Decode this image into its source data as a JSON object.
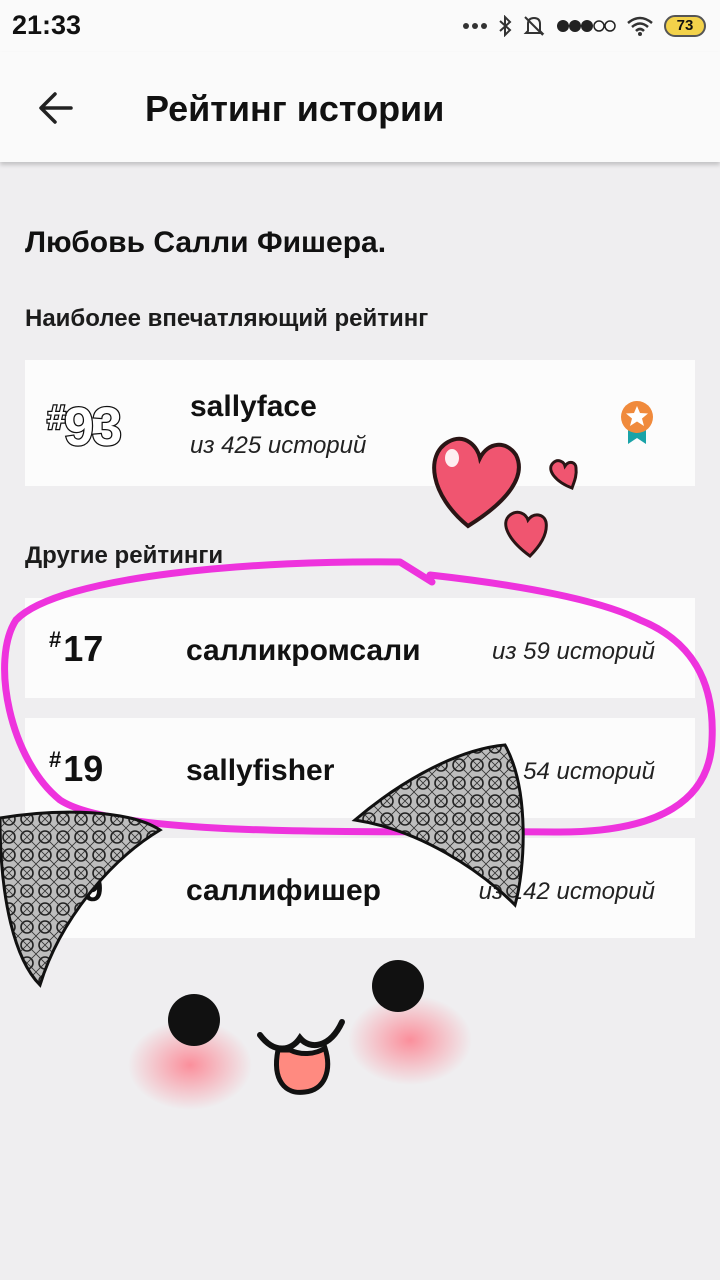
{
  "status_bar": {
    "time": "21:33",
    "battery": "73",
    "icons": [
      "more-dots-icon",
      "bluetooth-icon",
      "mute-icon",
      "signal-icon",
      "wifi-icon",
      "battery-icon"
    ]
  },
  "app_bar": {
    "back_icon": "arrow-left-icon",
    "title": "Рейтинг истории"
  },
  "story": {
    "title": "Любовь Салли Фишера."
  },
  "best": {
    "heading": "Наиболее впечатляющий рейтинг",
    "rank_hash": "#",
    "rank_num": "93",
    "tag": "sallyface",
    "count": "из 425 историй",
    "badge_icon": "medal-icon"
  },
  "others": {
    "heading": "Другие рейтинги",
    "rows": [
      {
        "rank_hash": "#",
        "rank_num": "17",
        "tag": "салликромсали",
        "count": "из 59 историй"
      },
      {
        "rank_hash": "#",
        "rank_num": "19",
        "tag": "sallyfisher",
        "count": "из 54 историй"
      },
      {
        "rank_hash": "#",
        "rank_num": "59",
        "tag": "саллифишер",
        "count": "из 142 историй"
      }
    ]
  },
  "colors": {
    "marker": "#ee33dd",
    "heart": "#f05570",
    "medal": "#f08a3c",
    "ribbon": "#1aa3a8"
  }
}
